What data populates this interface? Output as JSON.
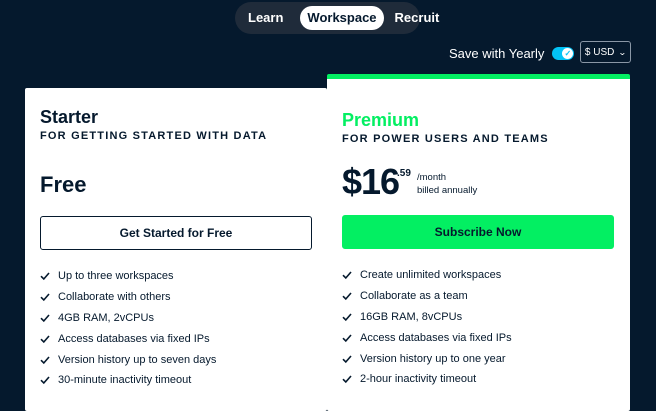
{
  "nav": {
    "tabs": [
      {
        "label": "Learn"
      },
      {
        "label": "Workspace",
        "active": true
      },
      {
        "label": "Recruit"
      }
    ]
  },
  "billing": {
    "yearly_label": "Save with Yearly",
    "yearly_on": true,
    "currency_label": "$ USD"
  },
  "colors": {
    "background": "#05192d",
    "accent_green": "#03ef62",
    "toggle_blue": "#03c3f6"
  },
  "plans": {
    "starter": {
      "name": "Starter",
      "subtitle": "FOR GETTING STARTED WITH DATA",
      "price": "Free",
      "cta": "Get Started for Free",
      "features": [
        "Up to three workspaces",
        "Collaborate with others",
        "4GB RAM, 2vCPUs",
        "Access databases via fixed IPs",
        "Version history up to seven days",
        "30-minute inactivity timeout"
      ]
    },
    "premium": {
      "name": "Premium",
      "subtitle": "FOR POWER USERS AND TEAMS",
      "price_main": "$16",
      "price_cents": ".59",
      "price_period": "/month",
      "price_billing": "billed annually",
      "cta": "Subscribe Now",
      "features": [
        "Create unlimited workspaces",
        "Collaborate as a team",
        "16GB RAM, 8vCPUs",
        "Access databases via fixed IPs",
        "Version history up to one year",
        "2-hour inactivity timeout"
      ]
    }
  }
}
